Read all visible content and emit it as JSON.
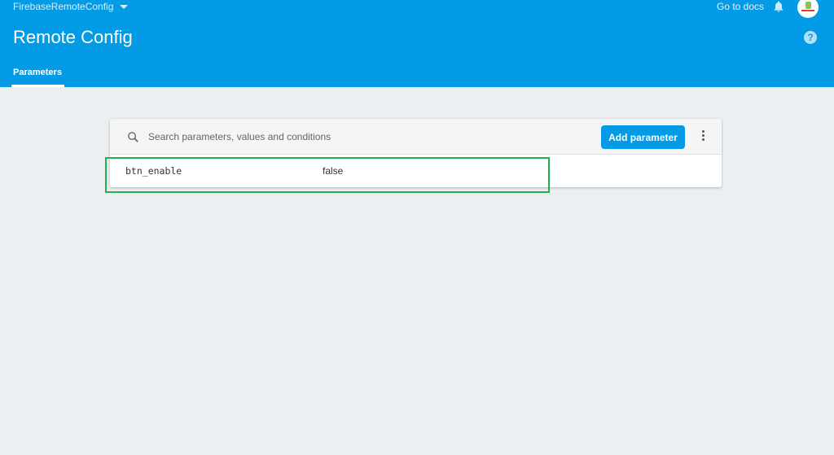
{
  "header": {
    "project": "FirebaseRemoteConfig",
    "title": "Remote Config",
    "go_to_docs": "Go to docs",
    "help": "?",
    "tabs": [
      {
        "label": "Parameters",
        "active": true
      }
    ]
  },
  "toolbar": {
    "search_placeholder": "Search parameters, values and conditions",
    "add_label": "Add parameter"
  },
  "parameters": [
    {
      "key": "btn_enable",
      "value": "false"
    }
  ],
  "colors": {
    "header": "#039be5",
    "highlight": "#22b14c"
  }
}
